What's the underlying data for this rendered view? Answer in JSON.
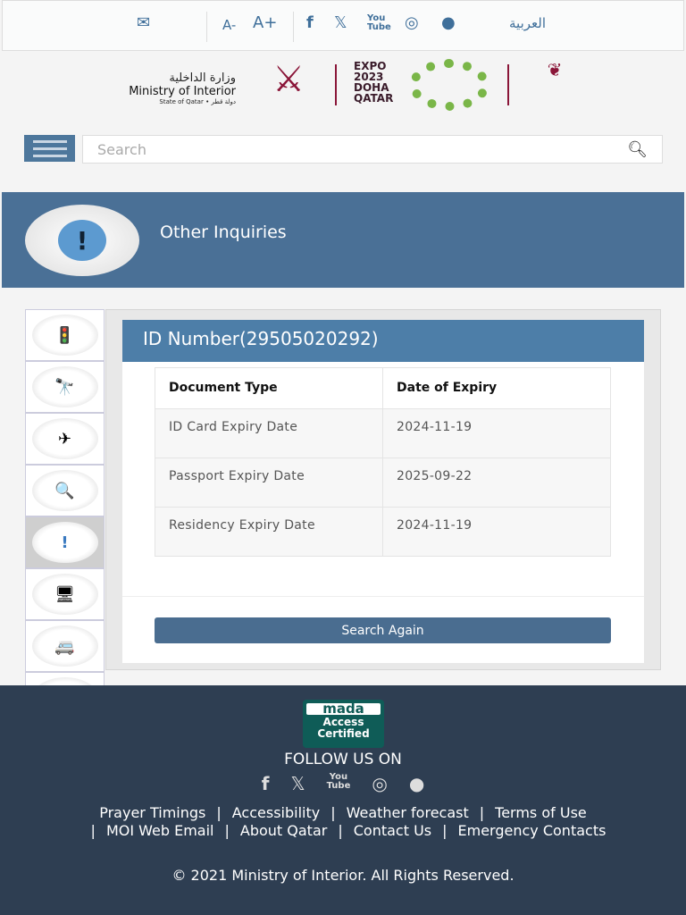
{
  "topbar": {
    "font_decrease": "A-",
    "font_increase": "A+",
    "language": "العربية",
    "icons": [
      "mail-icon",
      "facebook-icon",
      "x-icon",
      "youtube-icon",
      "instagram-icon",
      "snapchat-icon"
    ]
  },
  "logos": {
    "moi_ar": "وزارة الداخلية",
    "moi_en": "Ministry of Interior",
    "moi_state": "State of Qatar • دولة قطر",
    "expo": "EXPO 2023 DOHA QATAR"
  },
  "search": {
    "placeholder": "Search"
  },
  "banner": {
    "title": "Other Inquiries"
  },
  "side_icons": [
    "traffic-light-icon",
    "binoculars-icon",
    "airplane-icon",
    "magnifier-document-icon",
    "inquiry-bubble-icon",
    "computer-user-icon",
    "vehicle-icon",
    "form-icon",
    "metrash-icon"
  ],
  "result": {
    "heading": "ID Number(29505020292)",
    "columns": [
      "Document Type",
      "Date of Expiry"
    ],
    "rows": [
      [
        "ID Card Expiry Date",
        "2024-11-19"
      ],
      [
        "Passport Expiry Date",
        "2025-09-22"
      ],
      [
        "Residency Expiry Date",
        "2024-11-19"
      ]
    ],
    "search_again": "Search Again"
  },
  "footer": {
    "mada_top": "mada",
    "mada_bottom": "Access Certified",
    "follow": "FOLLOW US ON",
    "links": [
      "Prayer Timings",
      "Accessibility",
      "Weather forecast",
      "Terms of Use",
      "MOI Web Email",
      "About Qatar",
      "Contact Us",
      "Emergency Contacts"
    ],
    "copyright": "© 2021 Ministry of Interior. All Rights Reserved."
  },
  "colors": {
    "primary": "#4a7096",
    "footer": "#2e3e52",
    "brand_maroon": "#8a1538"
  }
}
